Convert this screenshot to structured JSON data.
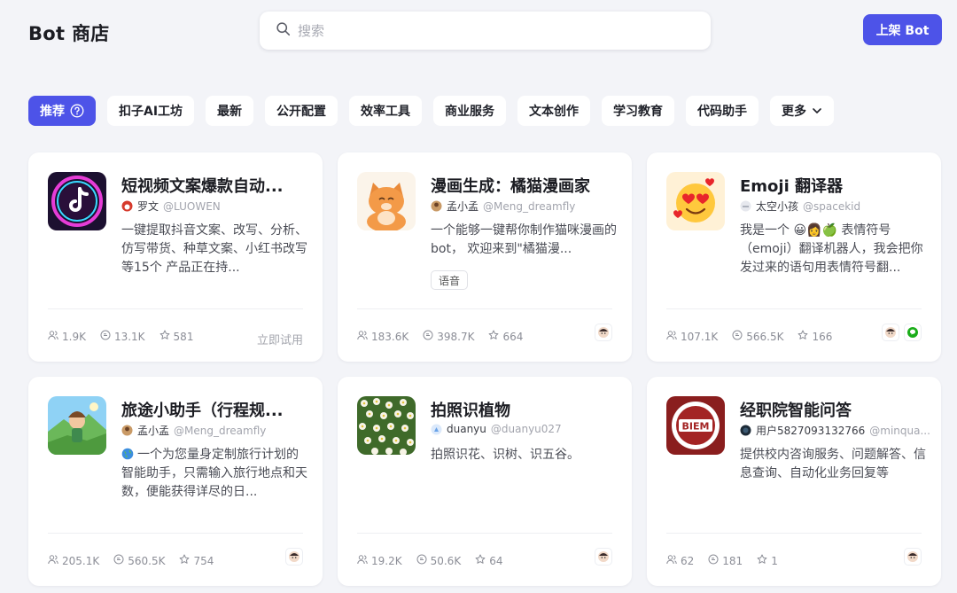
{
  "header": {
    "title": "Bot 商店",
    "search_placeholder": "搜索",
    "publish_label": "上架 Bot"
  },
  "tabs": [
    {
      "label": "推荐",
      "active": true
    },
    {
      "label": "扣子AI工坊"
    },
    {
      "label": "最新"
    },
    {
      "label": "公开配置"
    },
    {
      "label": "效率工具"
    },
    {
      "label": "商业服务"
    },
    {
      "label": "文本创作"
    },
    {
      "label": "学习教育"
    },
    {
      "label": "代码助手"
    },
    {
      "label": "更多"
    }
  ],
  "cards": [
    {
      "name": "短视频文案爆款自动...",
      "author": "罗文",
      "handle": "@LUOWEN",
      "description": "一键提取抖音文案、改写、分析、仿写带货、种草文案、小红书改写等15个 产品正在持...",
      "users": "1.9K",
      "chats": "13.1K",
      "stars": "581",
      "try_label": "立即试用"
    },
    {
      "name": "漫画生成：橘猫漫画家",
      "author": "孟小孟",
      "handle": "@Meng_dreamfly",
      "description": "一个能够一键帮你制作猫咪漫画的bot， 欢迎来到\"橘猫漫...",
      "tag": "语音",
      "users": "183.6K",
      "chats": "398.7K",
      "stars": "664"
    },
    {
      "name": "Emoji 翻译器",
      "author": "太空小孩",
      "handle": "@spacekid",
      "description": "我是一个 😀👩🍏 表情符号（emoji）翻译机器人，我会把你发过来的语句用表情符号翻...",
      "users": "107.1K",
      "chats": "566.5K",
      "stars": "166"
    },
    {
      "name": "旅途小助手（行程规...",
      "author": "孟小孟",
      "handle": "@Meng_dreamfly",
      "description": "一个为您量身定制旅行计划的智能助手，只需输入旅行地点和天数，便能获得详尽的日...",
      "users": "205.1K",
      "chats": "560.5K",
      "stars": "754"
    },
    {
      "name": "拍照识植物",
      "author": "duanyu",
      "handle": "@duanyu027",
      "description": "拍照识花、识树、识五谷。",
      "users": "19.2K",
      "chats": "50.6K",
      "stars": "64"
    },
    {
      "name": "经职院智能问答",
      "author": "用户5827093132766",
      "handle": "@minqua...",
      "description": "提供校内咨询服务、问题解答、信息查询、自动化业务回复等",
      "users": "62",
      "chats": "181",
      "stars": "1",
      "logo_text": "BIEM"
    }
  ],
  "colors": {
    "accent": "#4d53e8",
    "background": "#f3f4f8",
    "card": "#ffffff"
  }
}
